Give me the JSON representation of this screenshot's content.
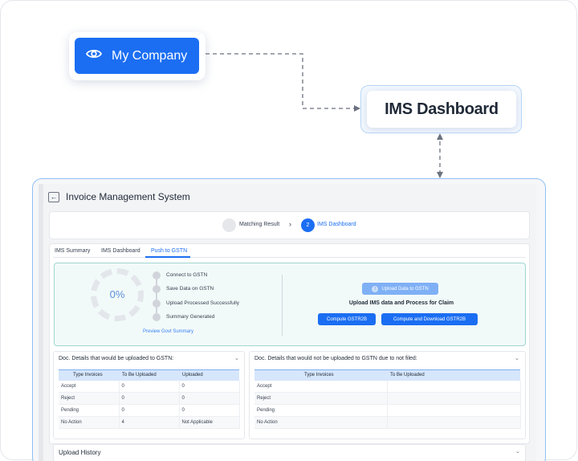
{
  "flow": {
    "company_label": "My Company",
    "ims_label": "IMS Dashboard"
  },
  "app": {
    "title": "Invoice Management System",
    "steps": [
      {
        "label": "Matching Result",
        "number": ""
      },
      {
        "label": "IMS Dashboard",
        "number": "2"
      }
    ],
    "tabs": [
      "IMS Summary",
      "IMS Dashboard",
      "Push to GSTN"
    ],
    "active_tab": "Push to GSTN",
    "progress": {
      "value_percent": 0,
      "label": "0%"
    },
    "timeline": [
      "Connect to GSTN",
      "Save Data on GSTN",
      "Upload Processed Successfully",
      "Summary Generated"
    ],
    "preview_link": "Preview Govt Summary",
    "upload_button": "Upload Data to GSTN",
    "upload_caption": "Upload IMS data and Process for Claim",
    "compute_button": "Compute GSTR2B",
    "compute_download_button": "Compute and Download GSTR2B",
    "uploaded_table": {
      "title": "Doc. Details that would be uploaded to GSTN:",
      "headers": [
        "Type Invoices",
        "To Be Uploaded",
        "Uploaded"
      ],
      "rows": [
        [
          "Accept",
          "0",
          "0"
        ],
        [
          "Reject",
          "0",
          "0"
        ],
        [
          "Pending",
          "0",
          "0"
        ],
        [
          "No Action",
          "4",
          "Not Applicable"
        ]
      ]
    },
    "not_uploaded_table": {
      "title": "Doc. Details that would not be uploaded to GSTN due to not filed:",
      "headers": [
        "Type Invoices",
        "To Be Uploaded"
      ],
      "rows": [
        [
          "Accept",
          ""
        ],
        [
          "Reject",
          ""
        ],
        [
          "Pending",
          ""
        ],
        [
          "No Action",
          ""
        ]
      ]
    },
    "upload_history_title": "Upload History"
  },
  "colors": {
    "primary": "#1b6ef2",
    "panel_bg": "#f2faf9",
    "table_header": "#d6e6fb"
  },
  "icons": {
    "company": "eye-icon",
    "back": "arrow-left-icon",
    "upload": "upload-icon",
    "collapse": "chevron-down-icon"
  }
}
